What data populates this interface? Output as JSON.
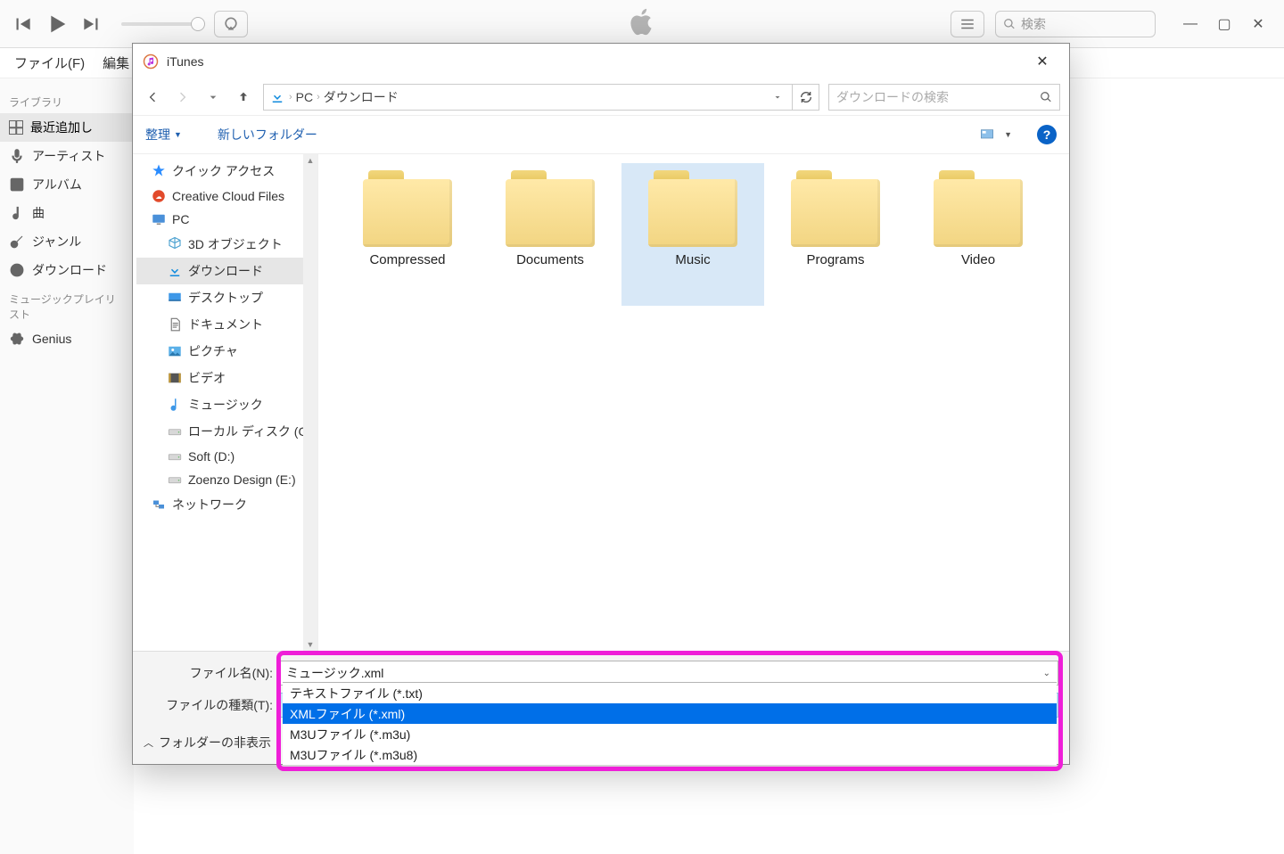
{
  "itunes": {
    "search_placeholder": "検索",
    "menu": {
      "file": "ファイル(F)",
      "edit": "編集"
    },
    "sidebar": {
      "library_label": "ライブラリ",
      "items": [
        {
          "label": "最近追加し"
        },
        {
          "label": "アーティスト"
        },
        {
          "label": "アルバム"
        },
        {
          "label": "曲"
        },
        {
          "label": "ジャンル"
        },
        {
          "label": "ダウンロード"
        }
      ],
      "playlists_label": "ミュージックプレイリスト",
      "genius": "Genius"
    }
  },
  "dialog": {
    "title": "iTunes",
    "breadcrumb": {
      "pc": "PC",
      "folder": "ダウンロード"
    },
    "search_placeholder": "ダウンロードの検索",
    "cmd": {
      "organize": "整理",
      "new_folder": "新しいフォルダー"
    },
    "tree": [
      {
        "label": "クイック アクセス",
        "icon": "star"
      },
      {
        "label": "Creative Cloud Files",
        "icon": "cc"
      },
      {
        "label": "PC",
        "icon": "pc"
      },
      {
        "label": "3D オブジェクト",
        "icon": "3d",
        "lvl": 2
      },
      {
        "label": "ダウンロード",
        "icon": "dl",
        "lvl": 2,
        "sel": true
      },
      {
        "label": "デスクトップ",
        "icon": "desk",
        "lvl": 2
      },
      {
        "label": "ドキュメント",
        "icon": "doc",
        "lvl": 2
      },
      {
        "label": "ピクチャ",
        "icon": "pic",
        "lvl": 2
      },
      {
        "label": "ビデオ",
        "icon": "vid",
        "lvl": 2
      },
      {
        "label": "ミュージック",
        "icon": "mus",
        "lvl": 2
      },
      {
        "label": "ローカル ディスク (C:)",
        "icon": "hdd",
        "lvl": 2
      },
      {
        "label": "Soft (D:)",
        "icon": "hdd",
        "lvl": 2
      },
      {
        "label": "Zoenzo Design (E:)",
        "icon": "hdd",
        "lvl": 2
      },
      {
        "label": "ネットワーク",
        "icon": "net"
      }
    ],
    "folders": [
      {
        "name": "Compressed"
      },
      {
        "name": "Documents"
      },
      {
        "name": "Music",
        "sel": true
      },
      {
        "name": "Programs"
      },
      {
        "name": "Video"
      }
    ],
    "filename_label": "ファイル名(N):",
    "filename_value": "ミュージック.xml",
    "filetype_label": "ファイルの種類(T):",
    "filetype_value": "XMLファイル (*.xml)",
    "filetype_options": [
      {
        "label": "テキストファイル (*.txt)"
      },
      {
        "label": "XMLファイル (*.xml)",
        "sel": true
      },
      {
        "label": "M3Uファイル (*.m3u)"
      },
      {
        "label": "M3Uファイル (*.m3u8)"
      }
    ],
    "hide_folders": "フォルダーの非表示"
  }
}
